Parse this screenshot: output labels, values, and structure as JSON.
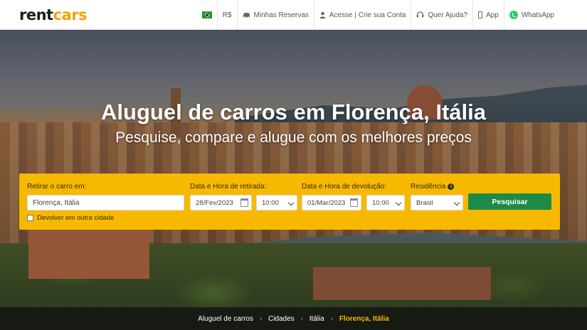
{
  "header": {
    "logo_part1": "rent",
    "logo_part2": "cars",
    "nav": {
      "currency": "R$",
      "reservations": "Minhas Reservas",
      "account": "Acesse | Crie sua Conta",
      "help": "Quer Ajuda?",
      "app": "App",
      "whatsapp": "WhatsApp"
    }
  },
  "hero": {
    "title": "Aluguel de carros em Florença, Itália",
    "subtitle": "Pesquise, compare e alugue com os melhores preços"
  },
  "search": {
    "pickup_label": "Retirar o carro em:",
    "pickup_value": "Florença, Itália",
    "pickup_date_label": "Data e Hora de retirada:",
    "pickup_date": "28/Fev/2023",
    "pickup_time": "10:00",
    "return_date_label": "Data e Hora de devolução:",
    "return_date": "01/Mar/2023",
    "return_time": "10:00",
    "residence_label": "Residência",
    "residence_value": "Brasil",
    "submit_label": "Pesquisar",
    "other_city_label": "Devolver em outra cidade"
  },
  "breadcrumb": {
    "items": [
      "Aluguel de carros",
      "Cidades",
      "Itália",
      "Florença, Itália"
    ]
  },
  "colors": {
    "accent": "#f7b900",
    "button": "#1e8a48",
    "logo_accent": "#f4a300"
  }
}
